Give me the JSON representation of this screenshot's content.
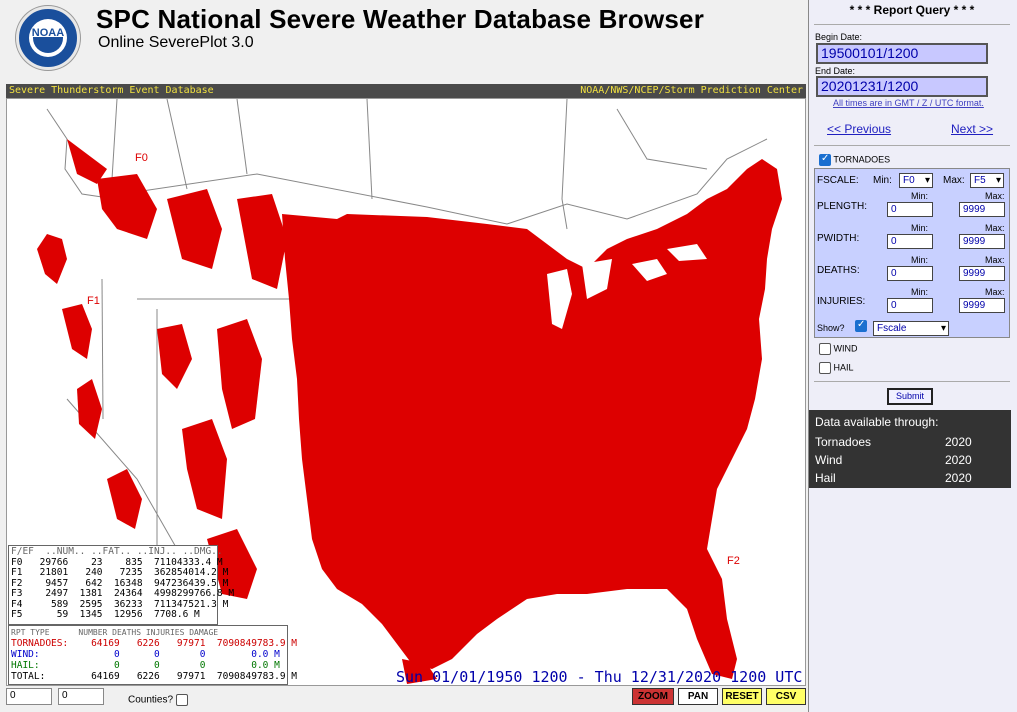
{
  "header": {
    "logo_text": "NOAA",
    "title": "SPC National Severe Weather Database Browser",
    "subtitle": "Online SeverePlot 3.0"
  },
  "strip": {
    "left": "Severe Thunderstorm Event Database",
    "right": "NOAA/NWS/NCEP/Storm Prediction Center"
  },
  "map": {
    "event_color": "#dd0000",
    "fscale_labels": [
      "F0",
      "F1",
      "F2"
    ]
  },
  "fscale_table": {
    "header": "F/EF  ..NUM.. ..FAT.. ..INJ.. ..DMG..",
    "rows": [
      "F0   29766    23    835  71104333.4 M",
      "F1   21801   240   7235  362854014.2 M",
      "F2    9457   642  16348  947236439.5 M",
      "F3    2497  1381  24364  4998299766.8 M",
      "F4     589  2595  36233  711347521.3 M",
      "F5      59  1345  12956  7708.6 M"
    ]
  },
  "totals_table": {
    "header": "RPT TYPE      NUMBER DEATHS INJURIES DAMAGE",
    "tornadoes": "TORNADOES:    64169   6226   97971  7090849783.9 M",
    "wind": "WIND:             0      0       0        0.0 M",
    "hail": "HAIL:             0      0       0        0.0 M",
    "total": "TOTAL:        64169   6226   97971  7090849783.9 M"
  },
  "date_range": "Sun 01/01/1950 1200 - Thu 12/31/2020 1200 UTC",
  "bottom": {
    "coord_x": "0",
    "coord_y": "0",
    "counties_label": "Counties?",
    "zoom": "ZOOM",
    "pan": "PAN",
    "reset": "RESET",
    "csv": "CSV"
  },
  "query": {
    "title": "* * * Report Query * * *",
    "begin_label": "Begin Date:",
    "begin_value": "19500101/1200",
    "end_label": "End Date:",
    "end_value": "20201231/1200",
    "gmt_note": "All times are in GMT / Z / UTC format.",
    "prev": "<< Previous",
    "next": "Next >>",
    "tornadoes_label": "TORNADOES",
    "fscale_label": "FSCALE:",
    "min_label": "Min:",
    "max_label": "Max:",
    "fscale_min": "F0",
    "fscale_max": "F5",
    "plength_label": "PLENGTH:",
    "pwidth_label": "PWIDTH:",
    "deaths_label": "DEATHS:",
    "injuries_label": "INJURIES:",
    "min_word": "Min:",
    "max_word": "Max:",
    "min_value": "0",
    "max_value": "9999",
    "show_label": "Show?",
    "show_value": "Fscale",
    "wind_label": "WIND",
    "hail_label": "HAIL",
    "submit": "Submit"
  },
  "availability": {
    "title": "Data available through:",
    "rows": [
      {
        "name": "Tornadoes",
        "year": "2020"
      },
      {
        "name": "Wind",
        "year": "2020"
      },
      {
        "name": "Hail",
        "year": "2020"
      }
    ]
  }
}
